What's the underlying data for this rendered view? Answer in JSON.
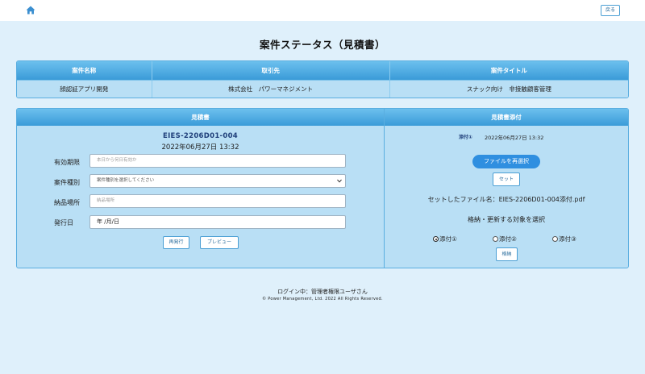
{
  "header": {
    "home_icon": "home-icon",
    "back_label": "戻る"
  },
  "page": {
    "title": "案件ステータス（見積書）"
  },
  "info_table": {
    "headers": [
      "案件名称",
      "取引先",
      "案件タイトル"
    ],
    "values": [
      "顔認証アプリ開発",
      "株式会社　パワーマネジメント",
      "スナック向け　非接触顧客管理"
    ]
  },
  "estimate": {
    "panel_title": "見積書",
    "doc_number": "EIES-2206D01-004",
    "doc_datetime": "2022年06月27日 13:32",
    "fields": {
      "validity": {
        "label": "有効期限",
        "placeholder": "本日から何日有効か"
      },
      "type": {
        "label": "案件種別",
        "selected": "案件種別を選択してください"
      },
      "delivery": {
        "label": "納品場所",
        "placeholder": "納品場所"
      },
      "issue_date": {
        "label": "発行日",
        "value": "年 /月/日"
      }
    },
    "reissue_label": "再発行",
    "preview_label": "プレビュー"
  },
  "attachment": {
    "panel_title": "見積書添付",
    "attach_label": "添付①",
    "attach_datetime": "2022年06月27日 13:32",
    "reselect_label": "ファイルを再選択",
    "set_label": "セット",
    "set_file_text": "セットしたファイル名：EIES-2206D01-004添付.pdf",
    "choose_target_text": "格納・更新する対象を選択",
    "radios": [
      "添付①",
      "添付②",
      "添付③"
    ],
    "selected_radio": "添付①",
    "store_label": "格納"
  },
  "footer": {
    "login_text": "ログイン中：管理者権限ユーザさん",
    "copyright": "© Power Management, Ltd. 2022 All Rights Reserved."
  },
  "colors": {
    "background": "#dff0fb",
    "header_blue": "#3a9bd8",
    "panel_body": "#b9dff5",
    "accent_button": "#2f8fe0"
  }
}
